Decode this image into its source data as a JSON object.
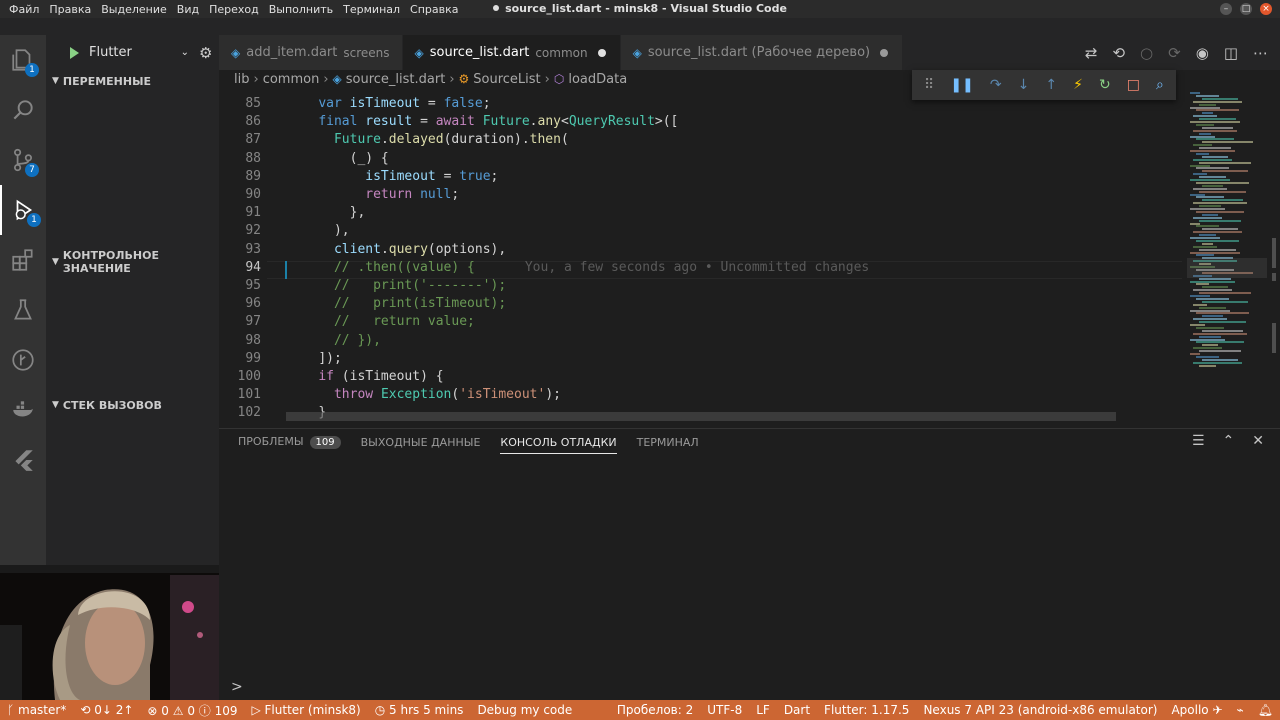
{
  "window": {
    "title": "source_list.dart - minsk8 - Visual Studio Code"
  },
  "menu": [
    "Файл",
    "Правка",
    "Выделение",
    "Вид",
    "Переход",
    "Выполнить",
    "Терминал",
    "Справка"
  ],
  "activity_badges": {
    "explorer": "1",
    "scm": "7",
    "debug": "1"
  },
  "debug_config": "Flutter",
  "sidebar": {
    "variables": "ПЕРЕМЕННЫЕ",
    "watch": "КОНТРОЛЬНОЕ ЗНАЧЕНИЕ",
    "callstack": "СТЕК ВЫЗОВОВ"
  },
  "tabs": [
    {
      "name": "add_item.dart",
      "desc": "screens"
    },
    {
      "name": "source_list.dart",
      "desc": "common"
    },
    {
      "name": "source_list.dart (Рабочее дерево)",
      "desc": ""
    }
  ],
  "breadcrumb": [
    "lib",
    "common",
    "source_list.dart",
    "SourceList",
    "loadData"
  ],
  "code_lines": [
    {
      "n": "85",
      "html": "    <span class='k'>var</span> <span class='v'>isTimeout</span> <span class='p'>=</span> <span class='k'>false</span><span class='p'>;</span>"
    },
    {
      "n": "86",
      "html": "    <span class='k'>final</span> <span class='v'>result</span> <span class='p'>=</span> <span class='kw'>await</span> <span class='t'>Future</span><span class='p'>.</span><span class='f'>any</span><span class='p'>&lt;</span><span class='t'>QueryResult</span><span class='p'>&gt;([</span>"
    },
    {
      "n": "87",
      "html": "      <span class='t'>Future</span><span class='p'>.</span><span class='f'>delayed</span><span class='p'>(duration).</span><span class='f'>then</span><span class='p'>(</span>"
    },
    {
      "n": "88",
      "html": "        <span class='p'>(_) {</span>"
    },
    {
      "n": "89",
      "html": "          <span class='v'>isTimeout</span> <span class='p'>=</span> <span class='k'>true</span><span class='p'>;</span>"
    },
    {
      "n": "90",
      "html": "          <span class='kw'>return</span> <span class='k'>null</span><span class='p'>;</span>"
    },
    {
      "n": "91",
      "html": "        <span class='p'>},</span>"
    },
    {
      "n": "92",
      "html": "      <span class='p'>),</span>"
    },
    {
      "n": "93",
      "html": "      <span class='v'>client</span><span class='p'>.</span><span class='f'>query</span><span class='p'>(options),</span>"
    },
    {
      "n": "94",
      "html": "      <span class='c'>// .then((value) {</span><span class='ghost'>You, a few seconds ago • Uncommitted changes</span>"
    },
    {
      "n": "95",
      "html": "      <span class='c'>//   print('-------');</span>"
    },
    {
      "n": "96",
      "html": "      <span class='c'>//   print(isTimeout);</span>"
    },
    {
      "n": "97",
      "html": "      <span class='c'>//   return value;</span>"
    },
    {
      "n": "98",
      "html": "      <span class='c'>// }),</span>"
    },
    {
      "n": "99",
      "html": "    <span class='p'>]);</span>"
    },
    {
      "n": "100",
      "html": "    <span class='kw'>if</span> <span class='p'>(isTimeout) {</span>"
    },
    {
      "n": "101",
      "html": "      <span class='kw'>throw</span> <span class='t'>Exception</span><span class='p'>(</span><span class='s'>'isTimeout'</span><span class='p'>);</span>"
    },
    {
      "n": "102",
      "html": "    <span class='p'>}</span>"
    }
  ],
  "panel": {
    "problems": "ПРОБЛЕМЫ",
    "problems_count": "109",
    "output": "ВЫХОДНЫЕ ДАННЫЕ",
    "debug_console": "КОНСОЛЬ ОТЛАДКИ",
    "terminal": "ТЕРМИНАЛ",
    "prompt": ">"
  },
  "status": {
    "branch": "master*",
    "sync": "0↓ 2↑",
    "problems": "⊗ 0 ⚠ 0 ⓘ 109",
    "flutter_run": "Flutter (minsk8)",
    "timer": "5 hrs 5 mins",
    "debug_mode": "Debug my code",
    "spaces": "Пробелов: 2",
    "encoding": "UTF-8",
    "eol": "LF",
    "language": "Dart",
    "flutter_version": "Flutter: 1.17.5",
    "device": "Nexus 7 API 23 (android-x86 emulator)",
    "apollo": "Apollo"
  },
  "colors": {
    "statusbar": "#cc6633",
    "accent": "#0e70c0"
  }
}
